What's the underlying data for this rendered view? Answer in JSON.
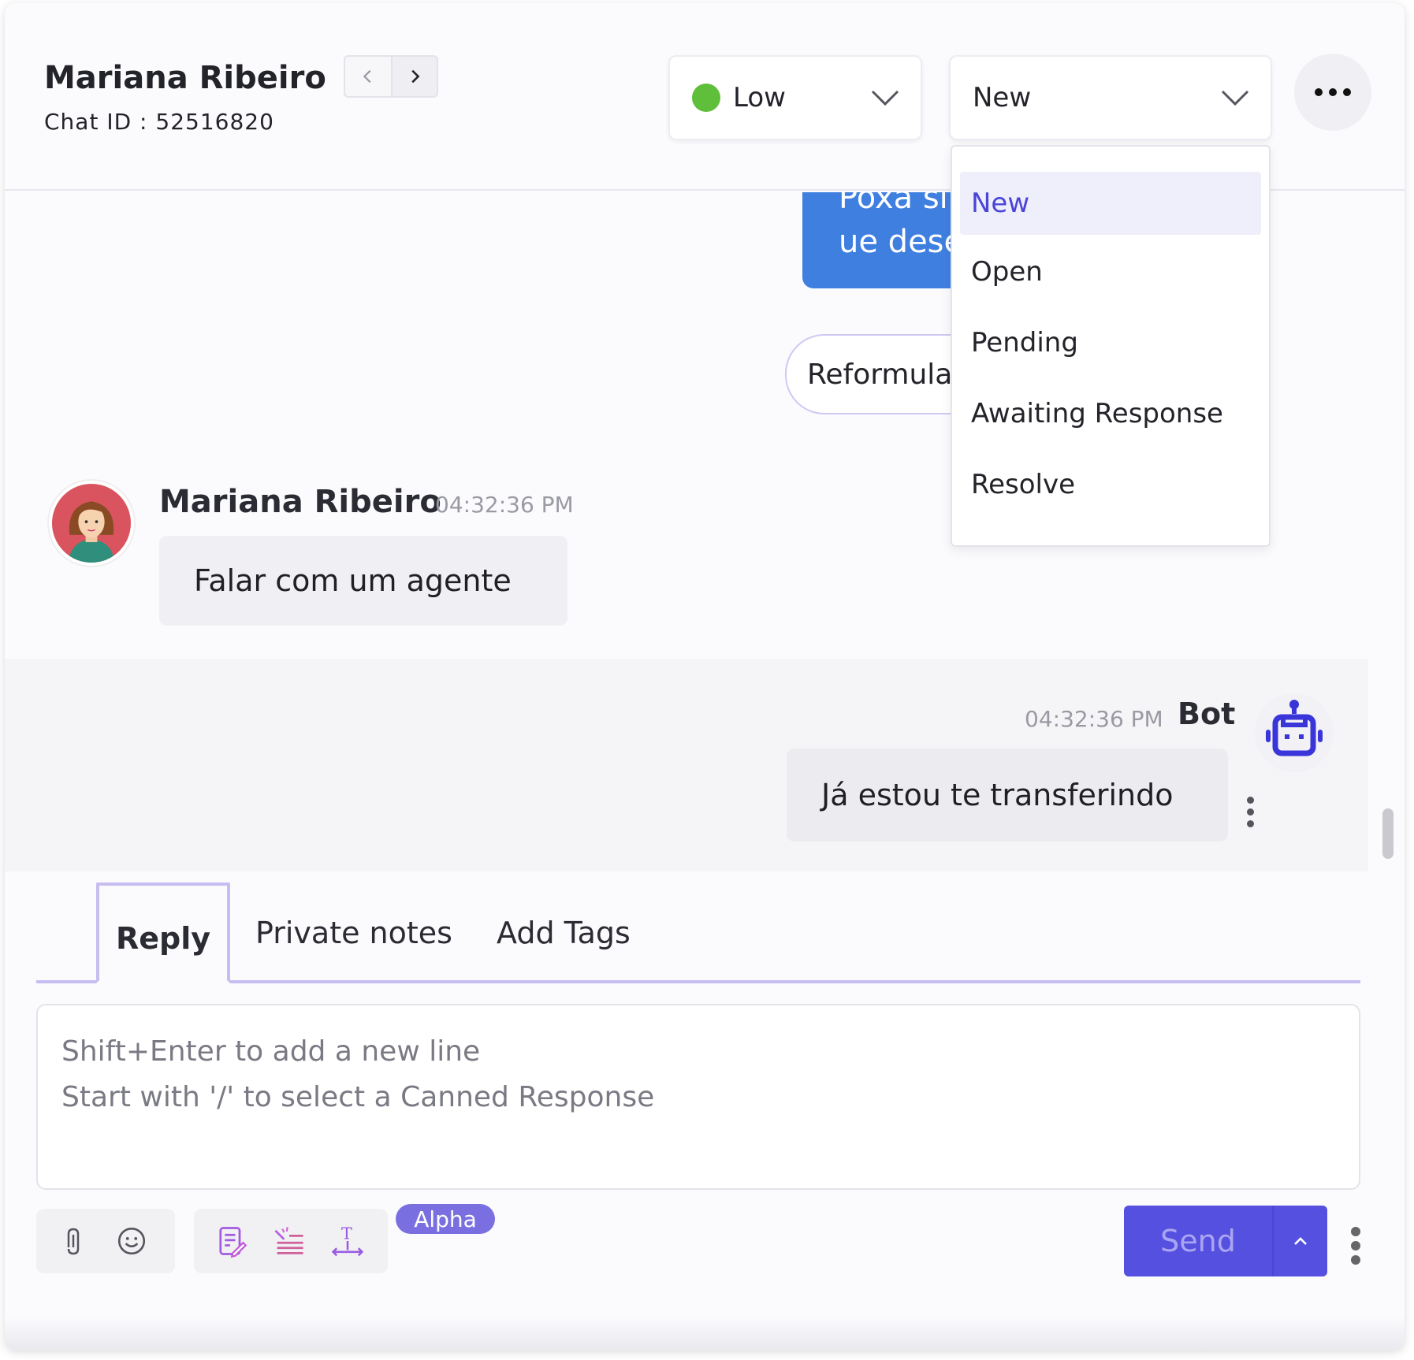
{
  "header": {
    "contact_name": "Mariana Ribeiro",
    "chat_id_label": "Chat ID : 52516820",
    "priority": {
      "value": "Low",
      "color": "#5fbf3a"
    },
    "status": {
      "value": "New"
    }
  },
  "status_dropdown": {
    "options": [
      "New",
      "Open",
      "Pending",
      "Awaiting Response",
      "Resolve"
    ],
    "selected": "New"
  },
  "messages": {
    "agent_partial": {
      "line1": "Poxa si",
      "line2": "ue dese"
    },
    "quick_reply": "Reformula",
    "user": {
      "name": "Mariana Ribeiro",
      "time": "04:32:36 PM",
      "text": "Falar com um agente"
    },
    "bot": {
      "name": "Bot",
      "time": "04:32:36 PM",
      "text": "Já estou te transferindo"
    }
  },
  "composer": {
    "tabs": [
      "Reply",
      "Private notes",
      "Add Tags"
    ],
    "active_tab": "Reply",
    "placeholder_line1": "Shift+Enter to add a new line",
    "placeholder_line2": "Start with '/' to select a Canned Response",
    "alpha_badge": "Alpha",
    "send_label": "Send"
  },
  "icons": {
    "attach": "paperclip-icon",
    "emoji": "smiley-icon",
    "ai_write": "document-pen-icon",
    "ai_rephrase": "magic-lines-icon",
    "ai_length": "text-expand-icon"
  },
  "colors": {
    "accent": "#5650e0",
    "agent_bubble": "#3f7fe0",
    "tab_border": "#c7bdf0"
  }
}
